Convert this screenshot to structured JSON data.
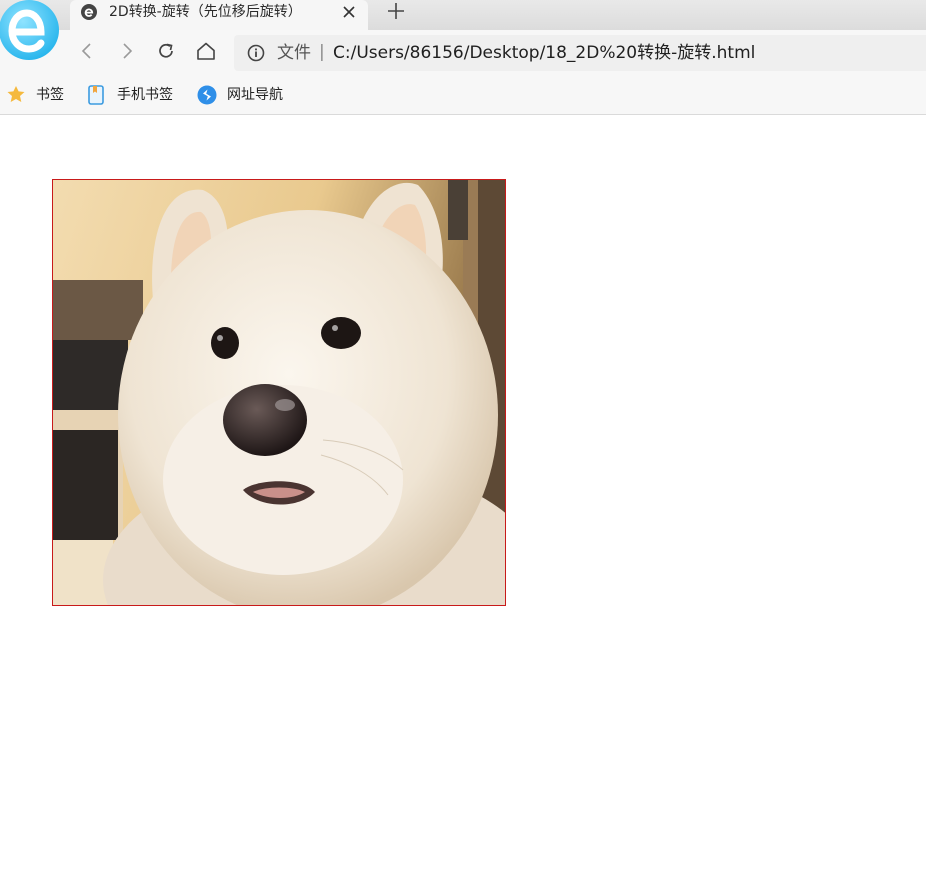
{
  "browser": {
    "tab": {
      "title": "2D转换-旋转（先位移后旋转）"
    },
    "address": {
      "file_label": "文件",
      "separator": "|",
      "url": "C:/Users/86156/Desktop/18_2D%20转换-旋转.html"
    },
    "bookmarks": [
      {
        "label": "书签",
        "icon": "star-icon"
      },
      {
        "label": "手机书签",
        "icon": "phone-bookmark-icon"
      },
      {
        "label": "网址导航",
        "icon": "navigation-icon"
      }
    ]
  },
  "page": {
    "image": {
      "subject": "dog-photo",
      "border_color": "#c81a1a"
    }
  }
}
